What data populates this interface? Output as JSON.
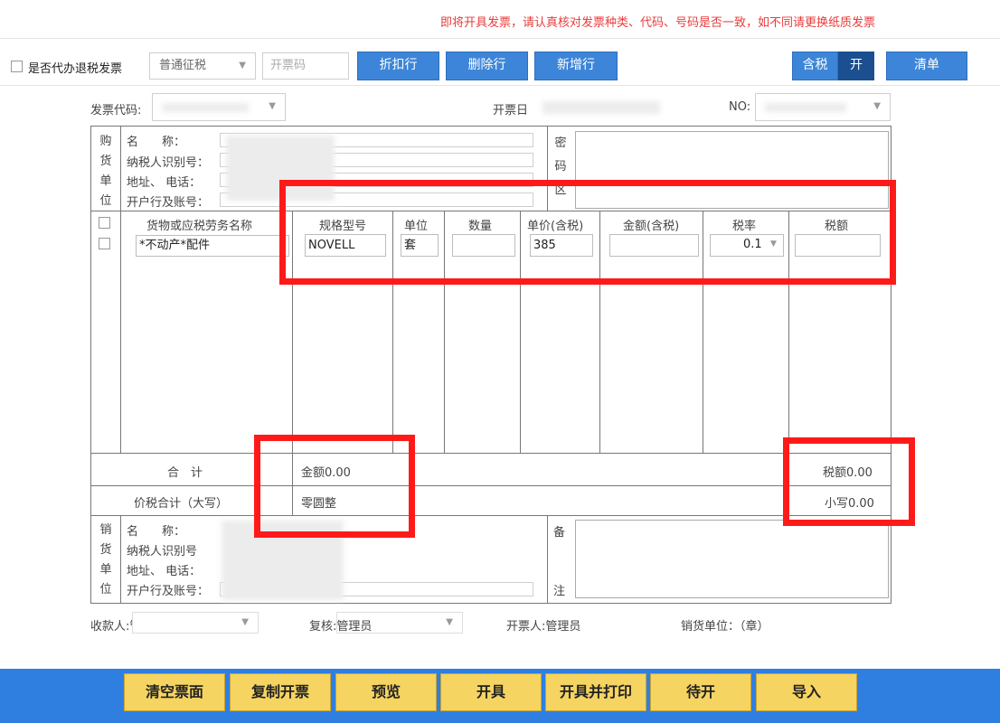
{
  "warning": "即将开具发票，请认真核对发票种类、代码、号码是否一致，如不同请更换纸质发票",
  "toolbar": {
    "agent_refund_label": "是否代办退税发票",
    "mode_select": "普通征税",
    "code_placeholder": "开票码",
    "discount_btn": "折扣行",
    "delete_btn": "删除行",
    "add_btn": "新增行",
    "tax_incl_label": "含税",
    "tax_incl_toggle": "开",
    "list_btn": "清单"
  },
  "header": {
    "invoice_code_label": "发票代码:",
    "date_label": "开票日",
    "no_label": "NO:"
  },
  "buyer": {
    "side": [
      "购",
      "货",
      "单",
      "位"
    ],
    "name_label": "名　　称：",
    "taxid_label": "纳税人识别号：",
    "addr_label": "地址、 电话：",
    "bank_label": "开户行及账号："
  },
  "cipher": [
    "密",
    "码",
    "区"
  ],
  "items": {
    "headers": [
      "货物或应税劳务名称",
      "规格型号",
      "单位",
      "数量",
      "单价(含税)",
      "金额(含税)",
      "税率",
      "税额"
    ],
    "row": {
      "name": "*不动产*配件",
      "spec": "NOVELL",
      "unit": "套",
      "qty": "",
      "price": "385",
      "amount": "",
      "rate": "0.1",
      "tax": ""
    }
  },
  "totals": {
    "sum_label": "合　计",
    "amount": "金额0.00",
    "tax": "税额0.00",
    "big_label": "价税合计（大写）",
    "big_value": "零圆整",
    "small": "小写0.00"
  },
  "seller": {
    "side": [
      "销",
      "货",
      "单",
      "位"
    ],
    "name_label": "名　　称：",
    "taxid_label": "纳税人识别号",
    "addr_label": "地址、 电话：",
    "bank_label": "开户行及账号："
  },
  "remark": [
    "备",
    "注"
  ],
  "signers": {
    "payee": "收款人:管理员",
    "reviewer": "复核:管理员",
    "drawer": "开票人:管理员",
    "seller_unit": "销货单位：（章）"
  },
  "footer_buttons": [
    "清空票面",
    "复制开票",
    "预览",
    "开具",
    "开具并打印",
    "待开",
    "导入"
  ],
  "colors": {
    "accent": "#3d85d8",
    "warning": "#e83c3c",
    "footer": "#2f7fe1",
    "footer_button": "#f5d461",
    "highlight": "#ff1a1a"
  }
}
